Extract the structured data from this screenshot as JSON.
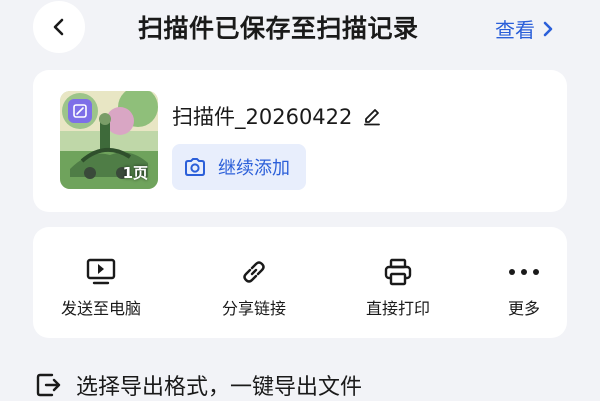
{
  "header": {
    "title": "扫描件已保存至扫描记录",
    "view_label": "查看"
  },
  "file_card": {
    "file_name": "扫描件_20260422",
    "page_count": "1页",
    "add_label": "继续添加"
  },
  "actions": [
    {
      "label": "发送至电脑",
      "icon": "monitor-send-icon"
    },
    {
      "label": "分享链接",
      "icon": "link-icon"
    },
    {
      "label": "直接打印",
      "icon": "printer-icon"
    },
    {
      "label": "更多",
      "icon": "more-dots-icon"
    }
  ],
  "export": {
    "text": "选择导出格式，一键导出文件"
  },
  "colors": {
    "accent": "#2b5fd9",
    "background": "#f2f3f7",
    "badge": "#7d6fe8"
  }
}
